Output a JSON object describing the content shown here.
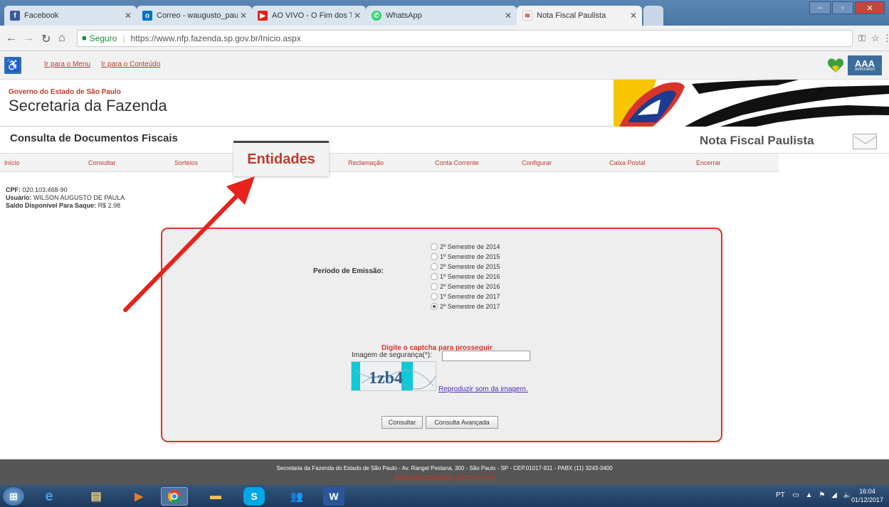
{
  "browser": {
    "tabs": [
      {
        "label": "Facebook",
        "icon": "facebook-icon",
        "color": "#3b5998"
      },
      {
        "label": "Correo - waugusto_pauli",
        "icon": "outlook-icon",
        "color": "#0072c6"
      },
      {
        "label": "AO VIVO - O Fim dos Te",
        "icon": "youtube-icon",
        "color": "#e62117"
      },
      {
        "label": "WhatsApp",
        "icon": "whatsapp-icon",
        "color": "#25d366"
      },
      {
        "label": "Nota Fiscal Paulista",
        "icon": "sp-flag-icon",
        "color": "#c0392b"
      }
    ],
    "address": {
      "secure_label": "Seguro",
      "url": "https://www.nfp.fazenda.sp.gov.br/Inicio.aspx"
    }
  },
  "site": {
    "accessibility_links": [
      "Ir para o Menu",
      "Ir para o Conteúdo"
    ],
    "gov_label": "Governo do Estado de São Paulo",
    "secretaria": "Secretaria da Fazenda",
    "page_title": "Consulta de Documentos Fiscais",
    "app_title": "Nota Fiscal Paulista",
    "aaa_badge": "AAA",
    "aaa_caption": "APROVADO"
  },
  "menu": {
    "items": [
      "Início",
      "Consultar",
      "Sorteios",
      "Entidades",
      "Reclamação",
      "Conta Corrente",
      "Configurar",
      "Caixa Postal",
      "Encerrar"
    ]
  },
  "user": {
    "cpf_label": "CPF:",
    "cpf": "020.103.468-90",
    "usuario_label": "Usuário:",
    "usuario": "WILSON AUGUSTO DE PAULA",
    "saldo_label": "Saldo Disponível Para Saque:",
    "saldo": "R$ 2.98"
  },
  "form": {
    "periodo_label": "Período de Emissão:",
    "periods": [
      {
        "label": "2º Semestre de 2014",
        "selected": false
      },
      {
        "label": "1º Semestre de 2015",
        "selected": false
      },
      {
        "label": "2º Semestre de 2015",
        "selected": false
      },
      {
        "label": "1º Semestre de 2016",
        "selected": false
      },
      {
        "label": "2º Semestre de 2016",
        "selected": false
      },
      {
        "label": "1º Semestre de 2017",
        "selected": false
      },
      {
        "label": "2º Semestre de 2017",
        "selected": true
      }
    ],
    "captcha_title": "Digite o captcha para prosseguir",
    "captcha_label": "Imagem de segurança(*):",
    "captcha_value": "",
    "captcha_text": "1zb4",
    "audio_link": "Reproduzir som da imagem.",
    "consultar_label": "Consultar",
    "avancada_label": "Consulta Avançada"
  },
  "footer": {
    "text": "Secretaria da Fazenda do Estado de São Paulo - Av. Rangel Pestana, 300 - São Paulo - SP - CEP.01017-911 - PABX (11) 3243-3400",
    "links": [
      "Política de Privacidade",
      "Termos de Uso"
    ]
  },
  "taskbar": {
    "language": "PT",
    "time": "16:04",
    "date": "01/12/2017"
  },
  "colors": {
    "accent_red": "#d9342b",
    "link_red": "#c0392b",
    "form_bg": "#eeeeee"
  }
}
